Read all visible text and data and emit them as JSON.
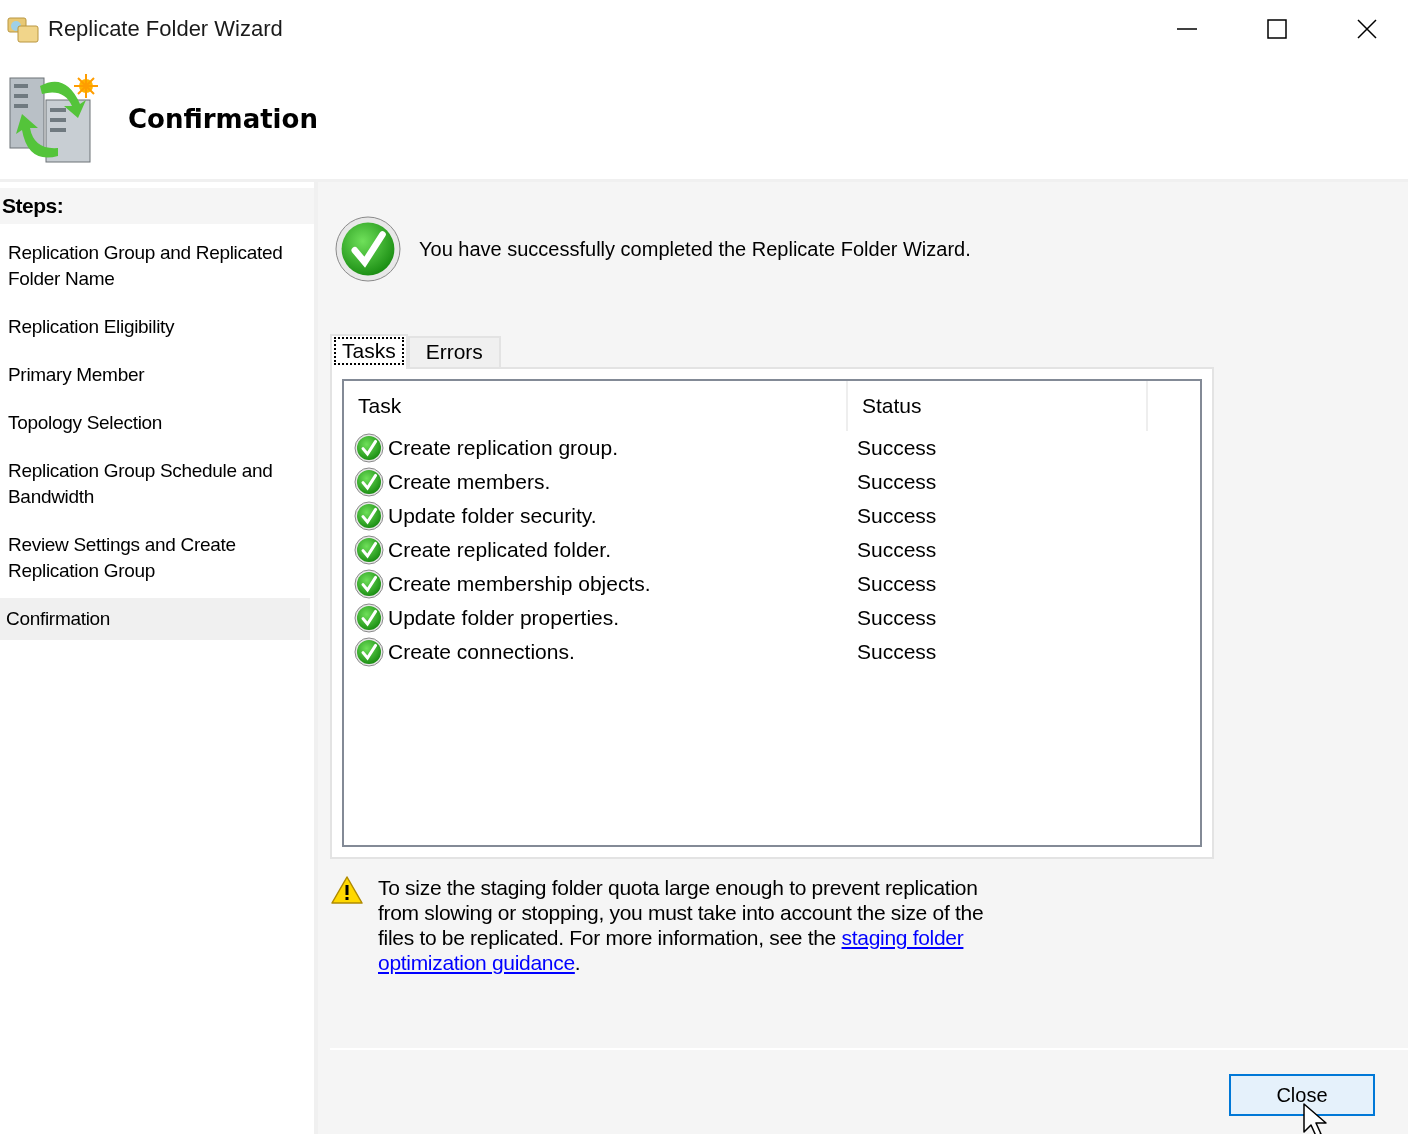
{
  "window": {
    "title": "Replicate Folder Wizard"
  },
  "header": {
    "title": "Confirmation"
  },
  "sidebar": {
    "heading": "Steps:",
    "items": [
      {
        "label": "Replication Group and Replicated Folder Name",
        "selected": false
      },
      {
        "label": "Replication Eligibility",
        "selected": false
      },
      {
        "label": "Primary Member",
        "selected": false
      },
      {
        "label": "Topology Selection",
        "selected": false
      },
      {
        "label": "Replication Group Schedule and Bandwidth",
        "selected": false
      },
      {
        "label": "Review Settings and Create Replication Group",
        "selected": false
      },
      {
        "label": "Confirmation",
        "selected": true
      }
    ]
  },
  "message": "You have successfully completed the Replicate Folder Wizard.",
  "tabs": [
    {
      "label": "Tasks",
      "selected": true
    },
    {
      "label": "Errors",
      "selected": false
    }
  ],
  "table": {
    "columns": [
      "Task",
      "Status"
    ],
    "rows": [
      {
        "task": "Create replication group.",
        "status": "Success",
        "kind": "success"
      },
      {
        "task": "Create members.",
        "status": "Success",
        "kind": "success"
      },
      {
        "task": "Update folder security.",
        "status": "Success",
        "kind": "success"
      },
      {
        "task": "Create replicated folder.",
        "status": "Success",
        "kind": "success"
      },
      {
        "task": "Create membership objects.",
        "status": "Success",
        "kind": "success"
      },
      {
        "task": "Update folder properties.",
        "status": "Success",
        "kind": "success"
      },
      {
        "task": "Create connections.",
        "status": "Success",
        "kind": "success"
      }
    ]
  },
  "warning": {
    "text": "To size the staging folder quota large enough to prevent replication from slowing or stopping, you must take into account the size of the files to be replicated. For more information, see the ",
    "link": [
      "staging folder",
      "optimization guidance"
    ],
    "after": "."
  },
  "buttons": [
    "Close"
  ]
}
